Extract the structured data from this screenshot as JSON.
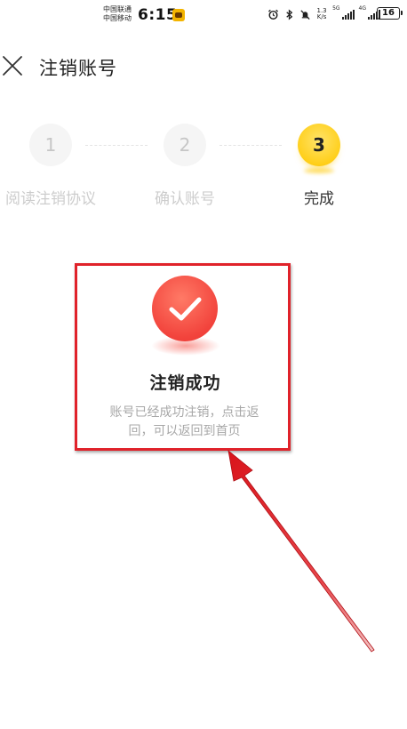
{
  "status_bar": {
    "carrier_1": "中国联通",
    "carrier_2": "中国移动",
    "time": "6:15",
    "speed_value": "1.3",
    "speed_unit": "K/s",
    "network_1": "5G",
    "network_2": "4G",
    "battery": "16",
    "icons": [
      "app-notification-icon",
      "alarm-icon",
      "bluetooth-icon",
      "mute-icon",
      "signal-icon",
      "signal-icon",
      "battery-icon"
    ]
  },
  "header": {
    "title": "注销账号",
    "close_icon": "close-icon"
  },
  "stepper": {
    "steps": [
      {
        "number": "1",
        "label": "阅读注销协议",
        "state": "done"
      },
      {
        "number": "2",
        "label": "确认账号",
        "state": "done"
      },
      {
        "number": "3",
        "label": "完成",
        "state": "current"
      }
    ]
  },
  "result": {
    "icon": "check-icon",
    "title": "注销成功",
    "description": "账号已经成功注销，点击返回，可以返回到首页"
  },
  "colors": {
    "accent_yellow": "#ffd21f",
    "success_red": "#f2433c",
    "annotation_red": "#e0222a",
    "muted_text": "#a8a8a8"
  }
}
